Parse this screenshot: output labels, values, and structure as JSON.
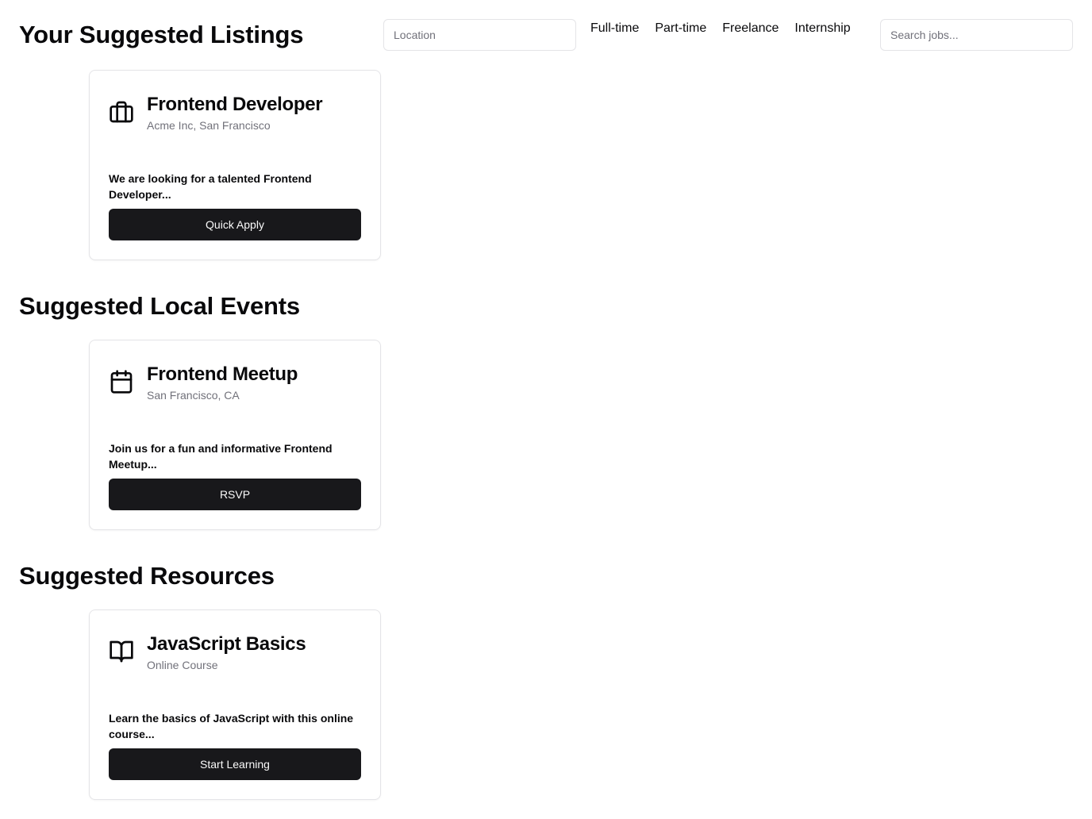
{
  "header": {
    "title": "Your Suggested Listings",
    "location_placeholder": "Location",
    "search_placeholder": "Search jobs...",
    "filters": [
      "Full-time",
      "Part-time",
      "Freelance",
      "Internship"
    ]
  },
  "listings": {
    "job": {
      "icon": "briefcase-icon",
      "title": "Frontend Developer",
      "subtitle": "Acme Inc, San Francisco",
      "description": "We are looking for a talented Frontend Developer...",
      "button": "Quick Apply"
    }
  },
  "events": {
    "section_title": "Suggested Local Events",
    "event": {
      "icon": "calendar-icon",
      "title": "Frontend Meetup",
      "subtitle": "San Francisco, CA",
      "description": "Join us for a fun and informative Frontend Meetup...",
      "button": "RSVP"
    }
  },
  "resources": {
    "section_title": "Suggested Resources",
    "resource": {
      "icon": "book-icon",
      "title": "JavaScript Basics",
      "subtitle": "Online Course",
      "description": "Learn the basics of JavaScript with this online course...",
      "button": "Start Learning"
    }
  }
}
